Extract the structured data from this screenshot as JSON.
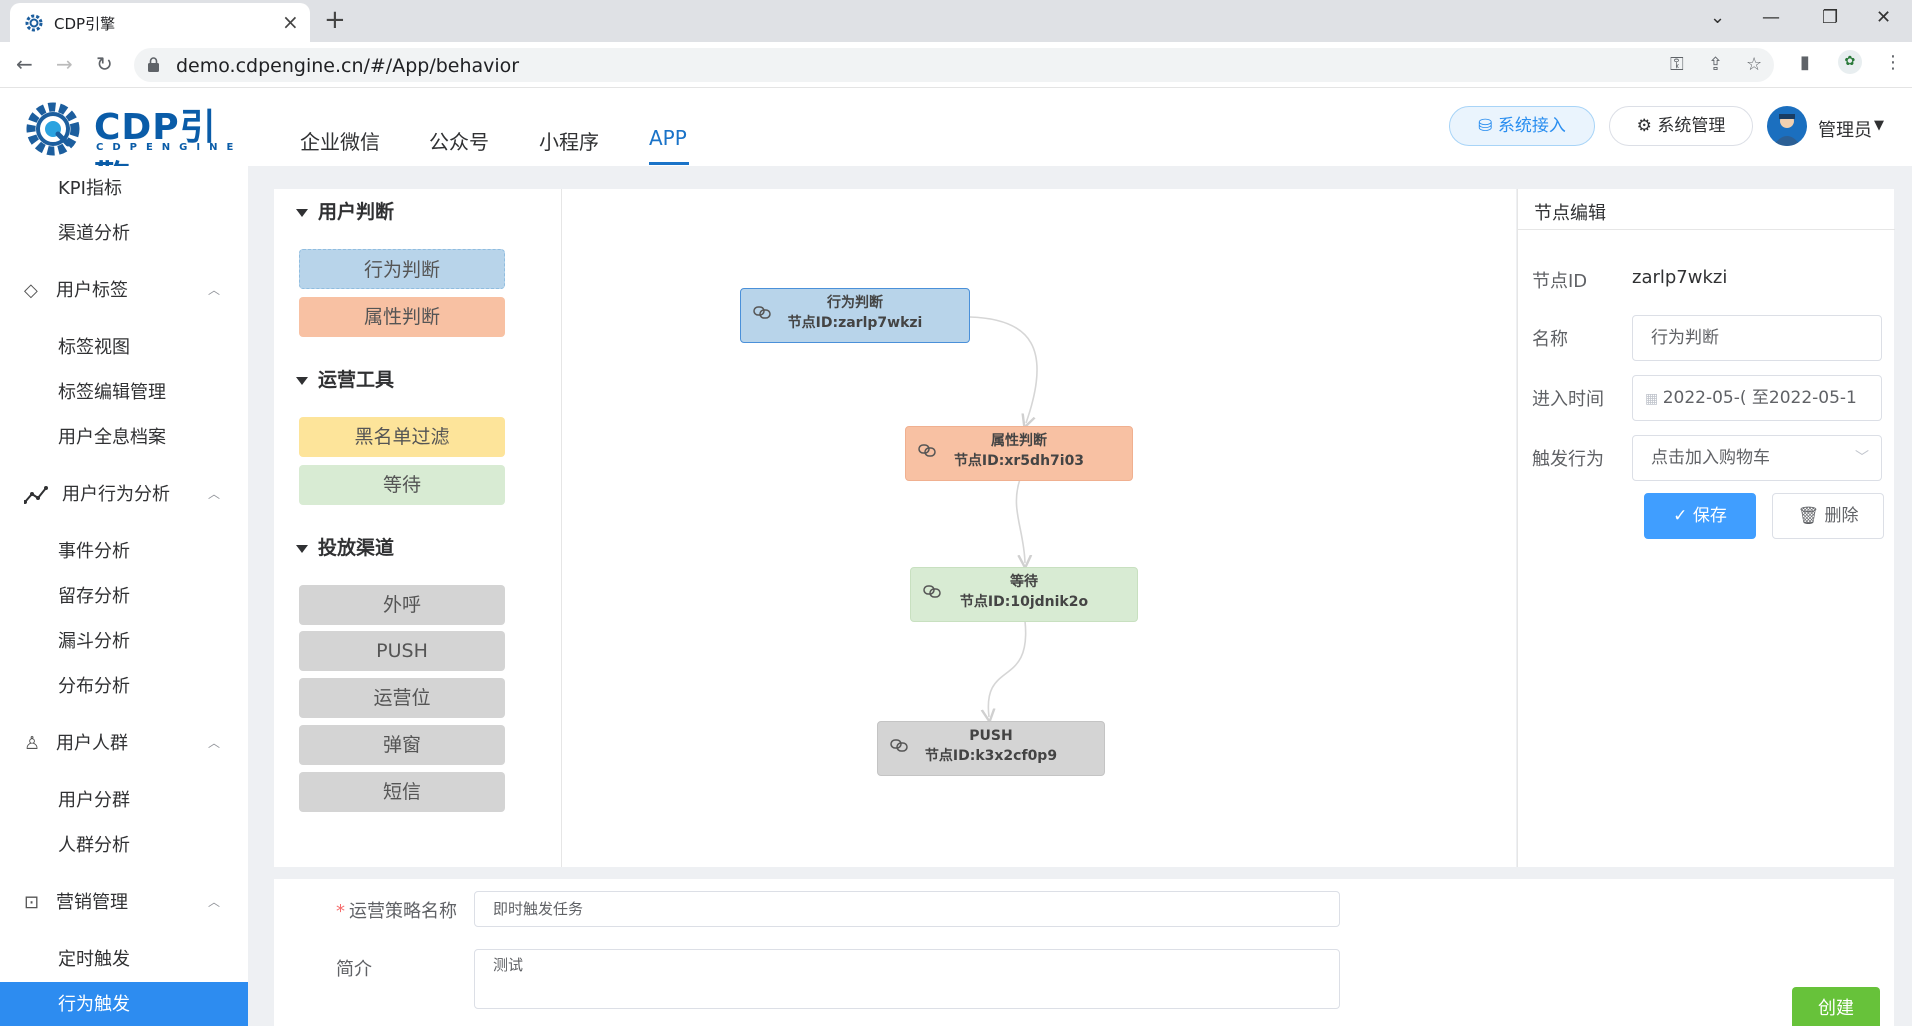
{
  "browser": {
    "tab_title": "CDP引擎",
    "url": "demo.cdpengine.cn/#/App/behavior"
  },
  "logo": {
    "text": "CDP引擎",
    "sub": "CDPENGINE"
  },
  "topnav": {
    "items": [
      {
        "label": "企业微信"
      },
      {
        "label": "公众号"
      },
      {
        "label": "小程序"
      },
      {
        "label": "APP"
      }
    ],
    "active": "APP"
  },
  "header": {
    "sys_access": "系统接入",
    "sys_manage": "系统管理",
    "user": "管理员"
  },
  "sidebar": {
    "kpi": "KPI指标",
    "channel": "渠道分析",
    "tags": "用户标签",
    "tag_view": "标签视图",
    "tag_edit": "标签编辑管理",
    "profile": "用户全息档案",
    "behavior": "用户行为分析",
    "event": "事件分析",
    "retention": "留存分析",
    "funnel": "漏斗分析",
    "distribution": "分布分析",
    "crowd": "用户人群",
    "segment": "用户分群",
    "crowd_analysis": "人群分析",
    "marketing": "营销管理",
    "timed": "定时触发",
    "behavior_trigger": "行为触发"
  },
  "palette": {
    "judge_title": "用户判断",
    "behavior_judge": "行为判断",
    "attr_judge": "属性判断",
    "ops_title": "运营工具",
    "blacklist": "黑名单过滤",
    "wait": "等待",
    "channel_title": "投放渠道",
    "call": "外呼",
    "push": "PUSH",
    "ops_slot": "运营位",
    "popup": "弹窗",
    "sms": "短信"
  },
  "nodes": [
    {
      "type": "行为判断",
      "id": "节点ID:zarlp7wkzi"
    },
    {
      "type": "属性判断",
      "id": "节点ID:xr5dh7i03"
    },
    {
      "type": "等待",
      "id": "节点ID:10jdnik2o"
    },
    {
      "type": "PUSH",
      "id": "节点ID:k3x2cf0p9"
    }
  ],
  "editor": {
    "title": "节点编辑",
    "id_label": "节点ID",
    "id_value": "zarlp7wkzi",
    "name_label": "名称",
    "name_value": "行为判断",
    "time_label": "进入时间",
    "time_value": "2022-05-( 至2022-05-1",
    "trigger_label": "触发行为",
    "trigger_value": "点击加入购物车",
    "save": "保存",
    "delete": "删除"
  },
  "form": {
    "name_label": "运营策略名称",
    "name_value": "即时触发任务",
    "desc_label": "简介",
    "desc_value": "测试",
    "create": "创建"
  },
  "colors": {
    "primary": "#409eff",
    "active_nav": "#1a73c8",
    "create": "#67c23a",
    "node_blue": "#b8d4ea",
    "node_orange": "#f8c1a3",
    "node_green": "#d8ebd3",
    "node_gray": "#d4d4d4",
    "chip_yellow": "#fde49a"
  }
}
